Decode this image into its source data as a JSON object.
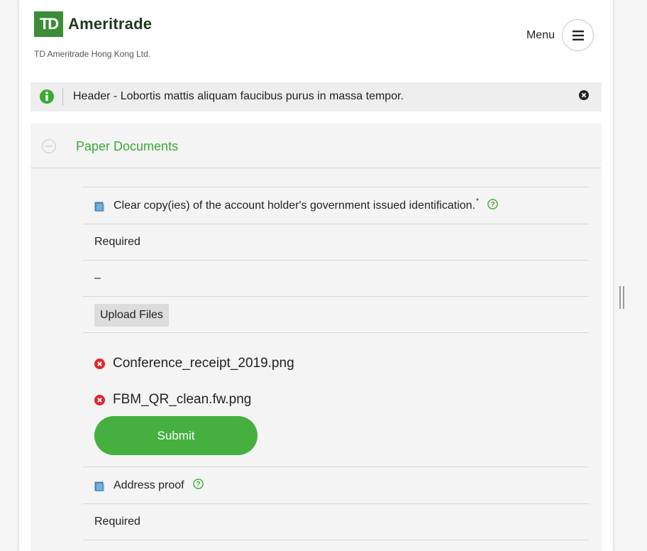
{
  "header": {
    "logo_mark": "TD",
    "logo_name": "Ameritrade",
    "subsidiary": "TD Ameritrade Hong Kong Ltd.",
    "menu_label": "Menu"
  },
  "alert": {
    "text": "Header - Lobortis mattis aliquam faucibus purus in massa tempor."
  },
  "section": {
    "title": "Paper Documents",
    "documents": [
      {
        "label": "Clear copy(ies) of the account holder's government issued identification.",
        "required_marker": "*",
        "status": "Required",
        "value": "–",
        "upload_label": "Upload Files",
        "files": [
          "Conference_receipt_2019.png",
          "FBM_QR_clean.fw.png"
        ],
        "submit_label": "Submit"
      },
      {
        "label": "Address proof",
        "status": "Required"
      }
    ]
  },
  "colors": {
    "brand_green": "#3b8d36",
    "accent_green": "#45b03f",
    "error_red": "#e0262b"
  }
}
